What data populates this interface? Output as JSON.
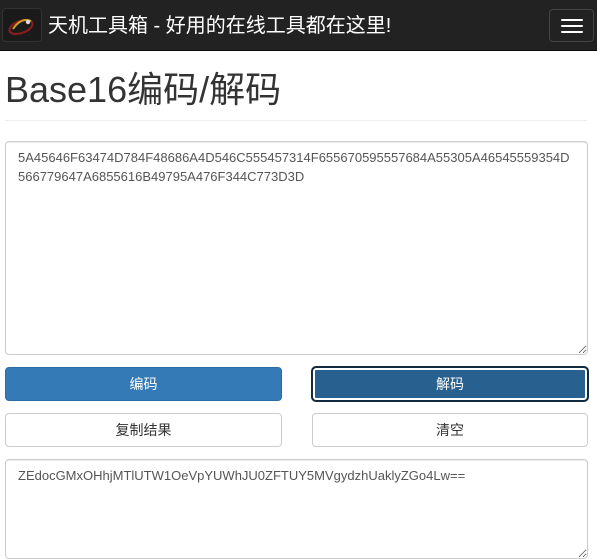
{
  "navbar": {
    "brand_text": "天机工具箱 - 好用的在线工具都在这里!",
    "logo_icon": "tianji-logo-icon",
    "menu_icon": "hamburger-menu-icon",
    "background": "#222222"
  },
  "page": {
    "title": "Base16编码/解码"
  },
  "input": {
    "value": "5A45646F63474D784F48686A4D546C555457314F655670595557684A55305A46545559354D566779647A6855616B49795A476F344C773D3D"
  },
  "buttons": {
    "encode_label": "编码",
    "decode_label": "解码",
    "copy_label": "复制结果",
    "clear_label": "清空"
  },
  "output": {
    "value": "ZEdocGMxOHhjMTlUTW1OeVpYUWhJU0ZFTUY5MVgydzhUaklyZGo4Lw=="
  },
  "colors": {
    "primary": "#337ab7",
    "primary_active": "#286090",
    "navbar": "#222222"
  }
}
